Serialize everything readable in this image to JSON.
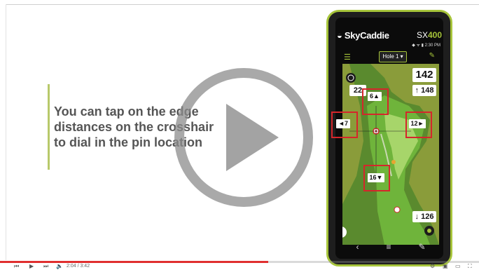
{
  "caption": {
    "line1": "You can tap on the edge",
    "line2": "distances on the crosshair",
    "line3": "to dial in the pin location"
  },
  "phone": {
    "brand": "SkyCaddie",
    "model_prefix": "SX",
    "model_number": "400",
    "status_time": "2:30 PM",
    "hole_label": "Hole 1",
    "distances": {
      "top": "142",
      "middle": "148",
      "bottom": "126",
      "layup": "22"
    },
    "edges": {
      "top": "6▲",
      "left": "◄7",
      "right": "12►",
      "bottom": "16▼"
    }
  },
  "player": {
    "time": "2:04 / 3:42",
    "progress": 0.56
  },
  "colors": {
    "accent": "#a6c43a",
    "highlight": "#d5262b",
    "progress": "#e02f2f"
  }
}
